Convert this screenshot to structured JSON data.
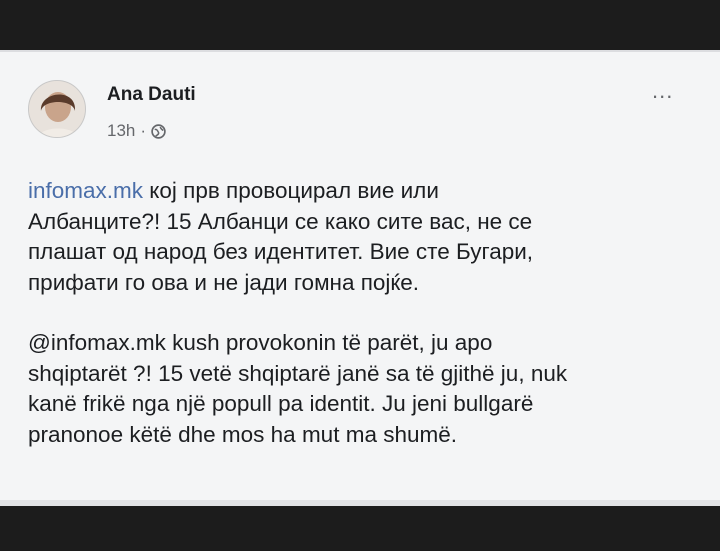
{
  "post": {
    "author": "Ana Dauti",
    "time": "13h",
    "separator": "·",
    "more_label": "...",
    "paragraph1": {
      "link": "infomax.mk",
      "text": " кој прв провоцирал вие или\nАлбанците?!  15 Албанци се како сите вас, не се\nплашат од народ без идентитет. Вие сте Бугари,\nприфати го ова и не јади гомна појќе."
    },
    "paragraph2": "@infomax.mk kush provokonin të parët, ju apo\nshqiptarët ?! 15 vetë shqiptarë janë sa të gjithë ju, nuk\nkanë frikë nga një popull pa identit. Ju jeni bullgarë\npranonoe këtë dhe mos ha mut ma shumë."
  },
  "icons": {
    "audience": "globe-icon",
    "menu": "more-options-icon"
  }
}
